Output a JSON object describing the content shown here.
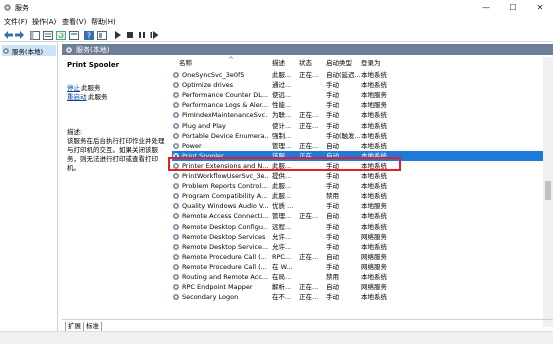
{
  "window": {
    "title": "服务",
    "controls": {
      "minimize": "—",
      "maximize": "☐",
      "close": "✕"
    }
  },
  "menu": [
    "文件(F)",
    "操作(A)",
    "查看(V)",
    "帮助(H)"
  ],
  "toolbar_icons": [
    "back-icon",
    "forward-icon",
    "show-tree-icon",
    "properties-icon",
    "refresh-icon",
    "export-icon",
    "help-icon",
    "view-icon",
    "start-icon",
    "stop-icon",
    "pause-icon",
    "restart-icon"
  ],
  "tree": {
    "selected_label": "服务(本地)"
  },
  "content_header": "服务(本地)",
  "details": {
    "service_name": "Print Spooler",
    "stop_link": "停止",
    "stop_suffix": "此服务",
    "restart_link": "重启动",
    "restart_suffix": "此服务",
    "description_label": "描述:",
    "description_text": "该服务在后台执行打印作业并处理与打印机的交互。如果关闭该服务，则无法进行打印或查看打印机。"
  },
  "columns": [
    "名称",
    "描述",
    "状态",
    "启动类型",
    "登录为"
  ],
  "services": [
    {
      "name": "OneSyncSvc_3e0f5",
      "desc": "此服...",
      "status": "正在...",
      "startup": "自动(延迟...",
      "logon": "本地系统"
    },
    {
      "name": "Optimize drives",
      "desc": "通过...",
      "status": "",
      "startup": "手动",
      "logon": "本地系统"
    },
    {
      "name": "Performance Counter DL...",
      "desc": "使远...",
      "status": "",
      "startup": "手动",
      "logon": "本地服务"
    },
    {
      "name": "Performance Logs & Aler...",
      "desc": "性能...",
      "status": "",
      "startup": "手动",
      "logon": "本地服务"
    },
    {
      "name": "PimIndexMaintenanceSvc...",
      "desc": "为联...",
      "status": "正在...",
      "startup": "手动",
      "logon": "本地系统"
    },
    {
      "name": "Plug and Play",
      "desc": "使计...",
      "status": "正在...",
      "startup": "手动",
      "logon": "本地系统"
    },
    {
      "name": "Portable Device Enumera...",
      "desc": "强制...",
      "status": "",
      "startup": "手动(触发...",
      "logon": "本地系统"
    },
    {
      "name": "Power",
      "desc": "管理...",
      "status": "正在...",
      "startup": "自动",
      "logon": "本地系统"
    },
    {
      "name": "Print Spooler",
      "desc": "该服...",
      "status": "正在...",
      "startup": "自动",
      "logon": "本地系统",
      "selected": true
    },
    {
      "name": "Printer Extensions and N...",
      "desc": "此服...",
      "status": "",
      "startup": "手动",
      "logon": "本地系统"
    },
    {
      "name": "PrintWorkflowUserSvc_3e...",
      "desc": "提供...",
      "status": "",
      "startup": "手动",
      "logon": "本地系统"
    },
    {
      "name": "Problem Reports Control...",
      "desc": "此服...",
      "status": "",
      "startup": "手动",
      "logon": "本地系统"
    },
    {
      "name": "Program Compatibility A...",
      "desc": "此服...",
      "status": "",
      "startup": "禁用",
      "logon": "本地系统"
    },
    {
      "name": "Quality Windows Audio V...",
      "desc": "优质 ...",
      "status": "",
      "startup": "手动",
      "logon": "本地服务"
    },
    {
      "name": "Remote Access Connecti...",
      "desc": "管理...",
      "status": "正在...",
      "startup": "自动",
      "logon": "本地系统"
    },
    {
      "name": "Remote Desktop Configu...",
      "desc": "远程...",
      "status": "",
      "startup": "手动",
      "logon": "本地系统"
    },
    {
      "name": "Remote Desktop Services",
      "desc": "允许...",
      "status": "",
      "startup": "手动",
      "logon": "网络服务"
    },
    {
      "name": "Remote Desktop Service...",
      "desc": "允许...",
      "status": "",
      "startup": "手动",
      "logon": "本地系统"
    },
    {
      "name": "Remote Procedure Call (...",
      "desc": "RPC...",
      "status": "正在...",
      "startup": "自动",
      "logon": "网络服务"
    },
    {
      "name": "Remote Procedure Call (...",
      "desc": "在 W...",
      "status": "",
      "startup": "手动",
      "logon": "网络服务"
    },
    {
      "name": "Routing and Remote Acc...",
      "desc": "在局...",
      "status": "",
      "startup": "禁用",
      "logon": "本地系统"
    },
    {
      "name": "RPC Endpoint Mapper",
      "desc": "解析...",
      "status": "正在...",
      "startup": "自动",
      "logon": "网络服务"
    },
    {
      "name": "Secondary Logon",
      "desc": "在不...",
      "status": "正在...",
      "startup": "手动",
      "logon": "本地系统"
    }
  ],
  "tabs": [
    "扩展",
    "标准"
  ],
  "colors": {
    "header": "#6d7e96",
    "selection": "#1e79d8",
    "highlight": "#e0202a",
    "tree_select": "#cce4f7"
  }
}
